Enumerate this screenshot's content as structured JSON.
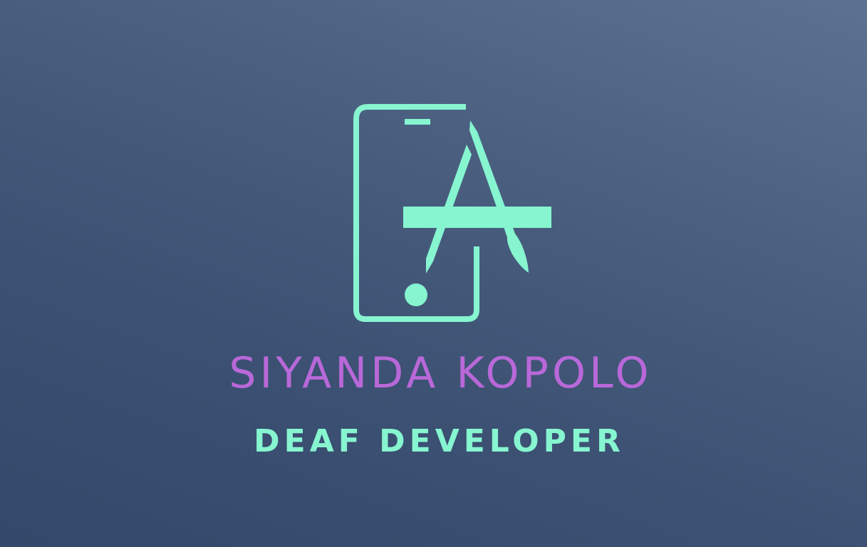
{
  "brand": {
    "name": "SIYANDA KOPOLO",
    "tagline": "DEAF DEVELOPER",
    "logo_icon": "phone-app-store-logo-icon"
  },
  "colors": {
    "background_light": "#5d7190",
    "background_dark": "#33486a",
    "name": "#b868d8",
    "accent": "#86f5d0"
  }
}
